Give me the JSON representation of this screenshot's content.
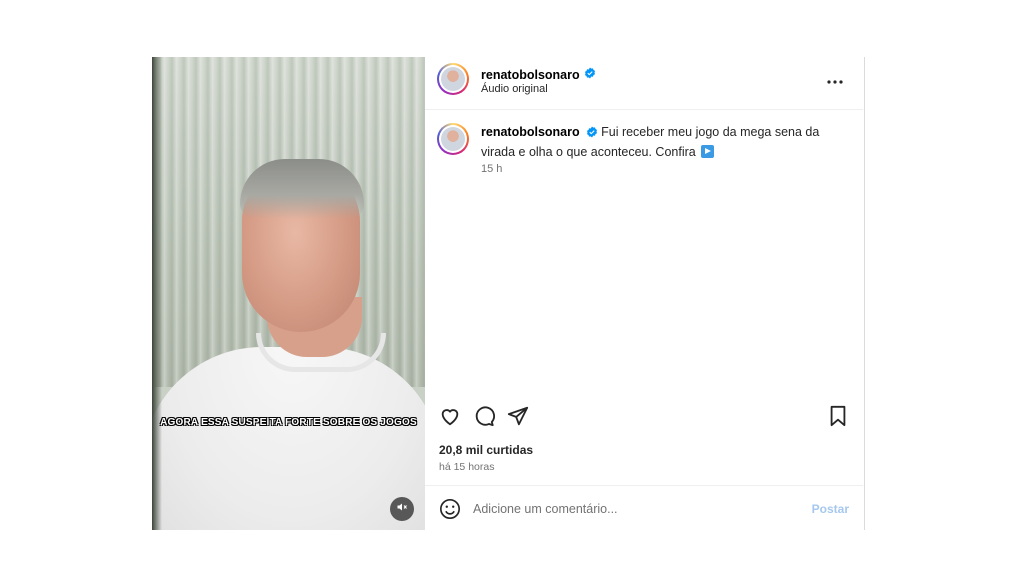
{
  "post": {
    "username": "renatobolsonaro",
    "audio": "Áudio original",
    "caption_text": "Fui receber meu jogo da mega sena da virada e olha o que aconteceu. Confira",
    "caption_emoji": "play-button-icon",
    "time_ago": "15 h",
    "likes": "20,8 mil curtidas",
    "posted": "há 15 horas"
  },
  "video": {
    "subtitle": "AGORA ESSA SUSPEITA FORTE SOBRE OS JOGOS",
    "muted": true
  },
  "comment": {
    "placeholder": "Adicione um comentário...",
    "post_label": "Postar"
  },
  "colors": {
    "verified": "#0095f6",
    "post_button_disabled": "#a6c8ef",
    "secondary_text": "#737373"
  },
  "icons": [
    "verified-badge-icon",
    "more-options-icon",
    "heart-icon",
    "comment-icon",
    "share-icon",
    "bookmark-icon",
    "emoji-icon",
    "volume-muted-icon"
  ]
}
